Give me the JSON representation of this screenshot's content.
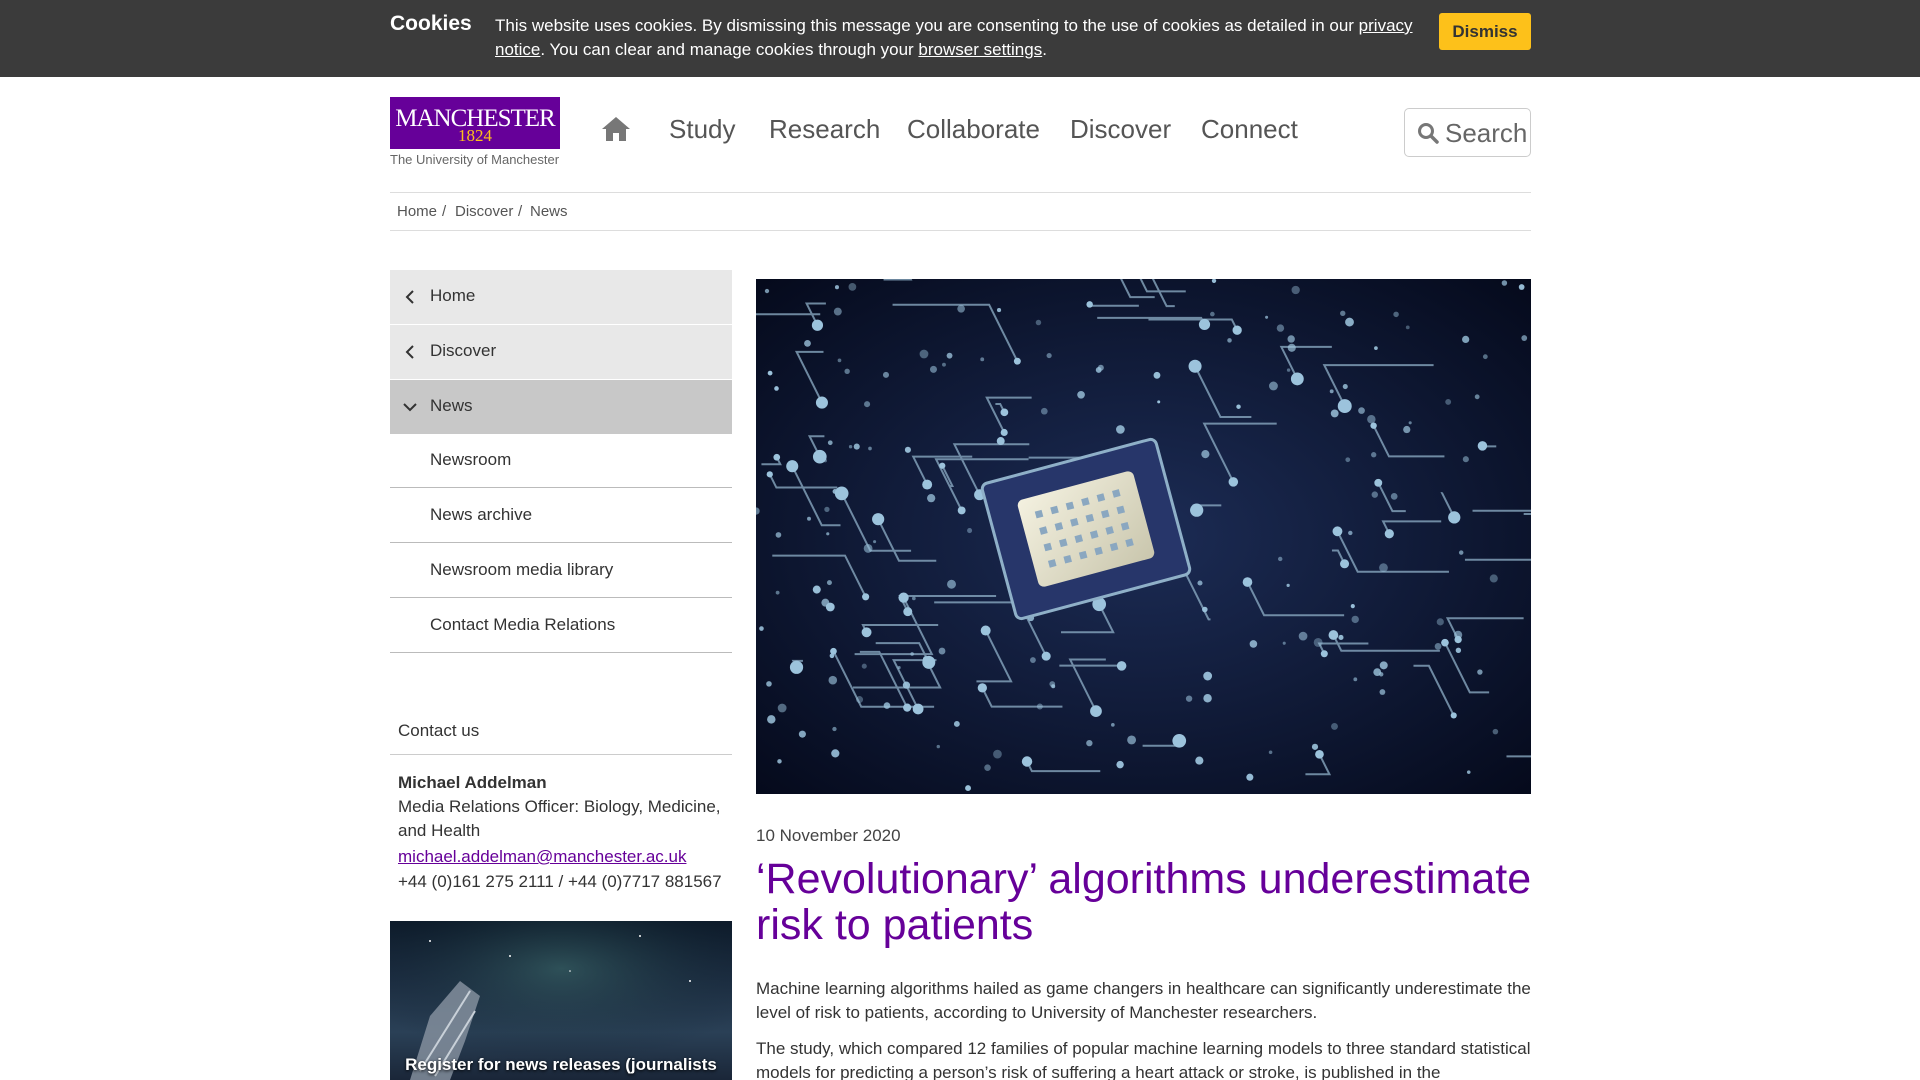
{
  "cookie_bar": {
    "title": "Cookies",
    "text_before": "This website uses cookies. By dismissing this message you are consenting to the use of cookies as detailed in our ",
    "privacy_link": "privacy notice",
    "text_middle": ". You can clear and manage cookies through your ",
    "browser_link": "browser settings",
    "text_after": ".",
    "dismiss_label": "Dismiss"
  },
  "header": {
    "logo_word": "MANCHESTER",
    "logo_year": "1824",
    "logo_subtitle": "The University of Manchester",
    "nav": [
      "Study",
      "Research",
      "Collaborate",
      "Discover",
      "Connect"
    ],
    "search_placeholder": "Search"
  },
  "breadcrumb": [
    "Home",
    "Discover",
    "News"
  ],
  "sidebar": {
    "parents": [
      "Home",
      "Discover"
    ],
    "active": "News",
    "children": [
      "Newsroom",
      "News archive",
      "Newsroom media library",
      "Contact Media Relations"
    ]
  },
  "contact": {
    "heading": "Contact us",
    "name": "Michael Addelman",
    "role": "Media Relations Officer: Biology, Medicine, and Health",
    "email": "michael.addelman@manchester.ac.uk",
    "phone": "+44 (0)161 275 2111 / +44 (0)7717 881567"
  },
  "promo": {
    "text": "Register for news releases (journalists"
  },
  "article": {
    "date": "10 November 2020",
    "title": "‘Revolutionary’ algorithms underestimate risk to patients",
    "lead": "Machine learning algorithms hailed as game changers in healthcare can significantly underestimate the level of risk to patients, according to University of Manchester researchers.",
    "body": "The study, which compared 12 families of popular machine learning models to three standard statistical models for predicting a person’s risk of suffering a heart attack or stroke, is published in the"
  },
  "colors": {
    "brand_purple": "#660099",
    "brand_gold": "#fdc11a",
    "cookie_bg": "#3b3b3b"
  },
  "icons": {
    "home": "home-icon",
    "search": "search-icon",
    "back": "chevron-left-icon",
    "expanded": "chevron-down-icon"
  }
}
